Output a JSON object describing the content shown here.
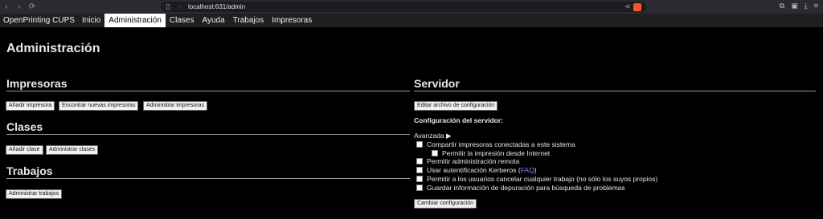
{
  "browser": {
    "url": "localhost:631/admin"
  },
  "nav": {
    "brand": "OpenPrinting CUPS",
    "items": [
      "Inicio",
      "Administración",
      "Clases",
      "Ayuda",
      "Trabajos",
      "Impresoras"
    ],
    "active_index": 1
  },
  "page": {
    "title": "Administración"
  },
  "printers": {
    "title": "Impresoras",
    "buttons": [
      "Añadir impresora",
      "Encontrar nuevas impresoras",
      "Administrar impresoras"
    ]
  },
  "classes": {
    "title": "Clases",
    "buttons": [
      "Añadir clase",
      "Administrar clases"
    ]
  },
  "jobs": {
    "title": "Trabajos",
    "buttons": [
      "Administrar trabajos"
    ]
  },
  "server": {
    "title": "Servidor",
    "edit_button": "Editar archivo de configuración",
    "config_label": "Configuración del servidor:",
    "advanced_link": "Avanzada ▶",
    "options": [
      {
        "text": "Compartir impresoras conectadas a este sistema",
        "checked": false
      },
      {
        "text": "Permitir la impresión desde Internet",
        "checked": false
      },
      {
        "text": "Permitir administración remota",
        "checked": false
      },
      {
        "text_prefix": "Usar autentificación Kerberos (",
        "link": "FAQ",
        "text_suffix": ")",
        "checked": false
      },
      {
        "text": "Permitir a los usuarios cancelar cualquier trabajo (no sólo los suyos propios)",
        "checked": false
      },
      {
        "text": "Guardar información de depuración para búsqueda de problemas",
        "checked": false
      }
    ],
    "change_button": "Cambiar configuración"
  }
}
